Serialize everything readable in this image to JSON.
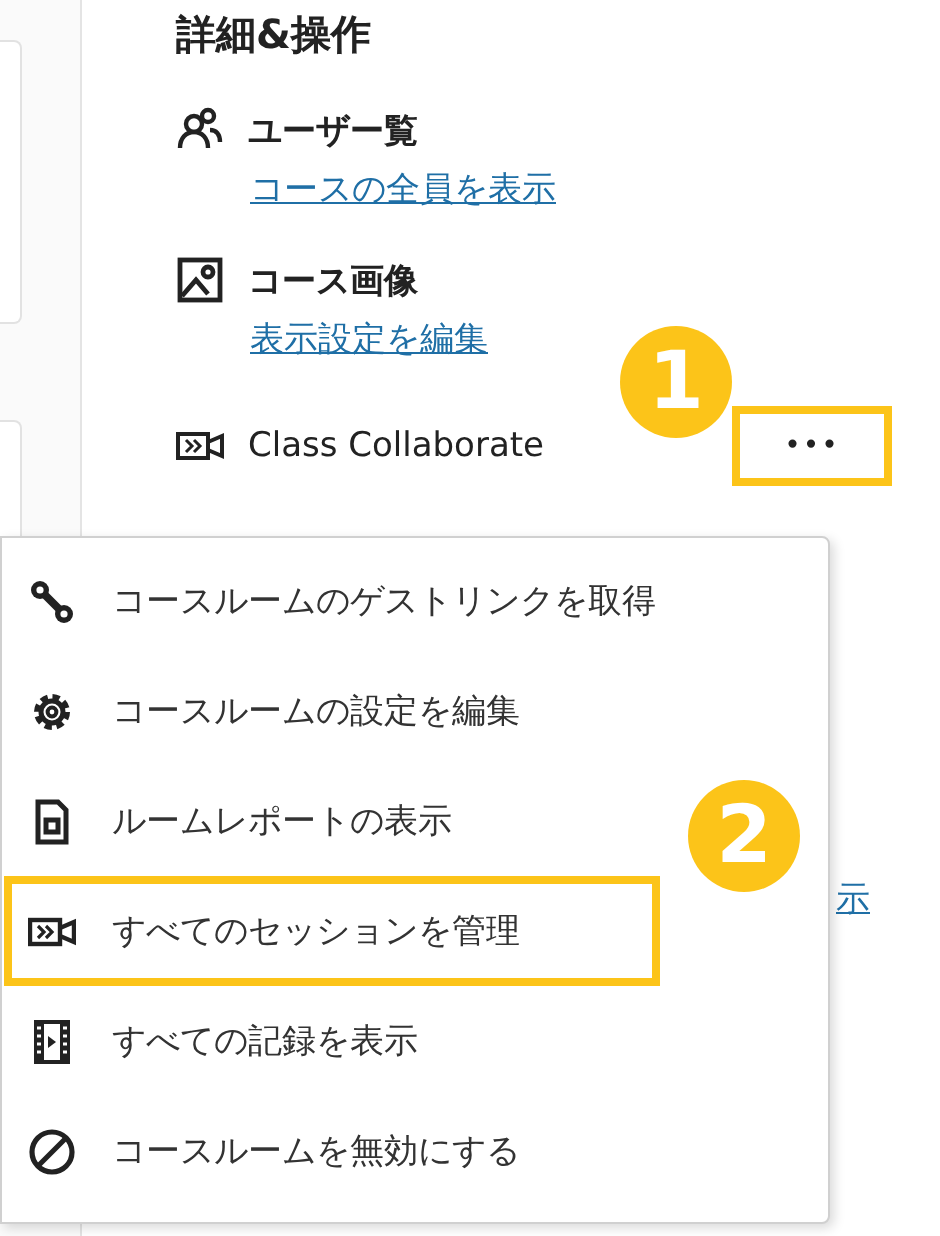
{
  "panel": {
    "heading": "詳細&操作",
    "items": [
      {
        "kind": "users",
        "title": "ユーザー覧",
        "link": "コースの全員を表示"
      },
      {
        "kind": "image",
        "title": "コース画像",
        "link": "表示設定を編集"
      }
    ],
    "collaborate": {
      "title": "Class Collaborate",
      "more_button": "•••",
      "highlighted": true
    },
    "link_fragment": "示"
  },
  "menu": {
    "items": [
      {
        "kind": "link",
        "label": "コースルームのゲストリンクを取得",
        "highlighted": false
      },
      {
        "kind": "gear",
        "label": "コースルームの設定を編集",
        "highlighted": false
      },
      {
        "kind": "report",
        "label": "ルームレポートの表示",
        "highlighted": false
      },
      {
        "kind": "camera",
        "label": "すべてのセッションを管理",
        "highlighted": true
      },
      {
        "kind": "film",
        "label": "すべての記録を表示",
        "highlighted": false
      },
      {
        "kind": "block",
        "label": "コースルームを無効にする",
        "highlighted": false
      }
    ]
  },
  "callouts": [
    {
      "number": "1"
    },
    {
      "number": "2"
    }
  ]
}
